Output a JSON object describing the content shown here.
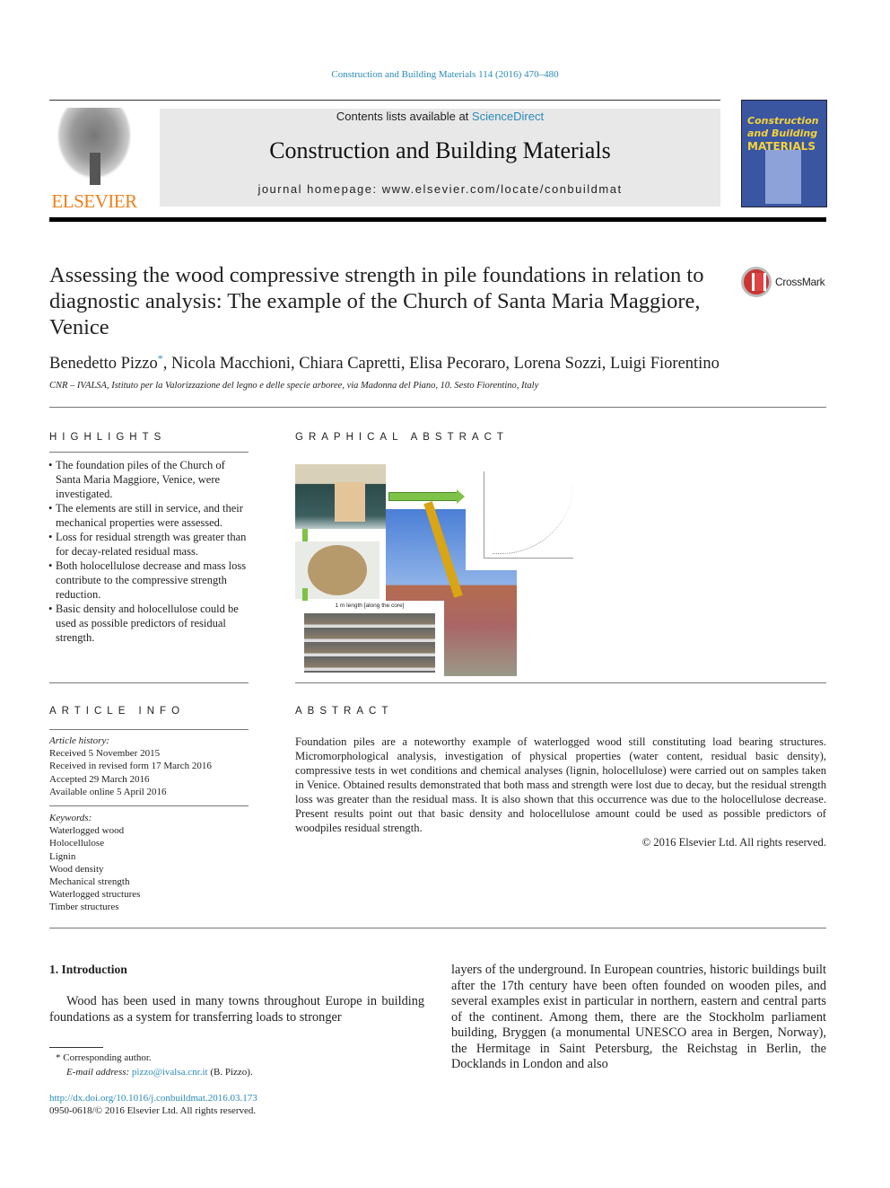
{
  "journal_ref": "Construction and Building Materials 114 (2016) 470–480",
  "header": {
    "publisher_logo_text": "ELSEVIER",
    "contents_prefix": "Contents lists available at ",
    "contents_link": "ScienceDirect",
    "journal_title": "Construction and Building Materials",
    "homepage": "journal homepage: www.elsevier.com/locate/conbuildmat",
    "cover": {
      "line1": "Construction",
      "line2": "and Building",
      "line3": "MATERIALS"
    }
  },
  "article": {
    "title": "Assessing the wood compressive strength in pile foundations in relation to diagnostic analysis: The example of the Church of Santa Maria Maggiore, Venice",
    "crossmark": "CrossMark",
    "first_author": "Benedetto Pizzo",
    "author_mark": "*",
    "other_authors": ", Nicola Macchioni, Chiara Capretti, Elisa Pecoraro, Lorena Sozzi, Luigi Fiorentino",
    "affiliation": "CNR – IVALSA, Istituto per la Valorizzazione del legno e delle specie arboree, via Madonna del Piano, 10. Sesto Fiorentino, Italy"
  },
  "highlights": {
    "heading": "HIGHLIGHTS",
    "items": [
      "The foundation piles of the Church of Santa Maria Maggiore, Venice, were investigated.",
      "The elements are still in service, and their mechanical properties were assessed.",
      "Loss for residual strength was greater than for decay-related residual mass.",
      "Both holocellulose decrease and mass loss contribute to the compressive strength reduction.",
      "Basic density and holocellulose could be used as possible predictors of residual strength."
    ]
  },
  "graphical_abstract": {
    "heading": "GRAPHICAL ABSTRACT",
    "core_caption": "1 m length [along the core]"
  },
  "article_info": {
    "heading": "ARTICLE INFO",
    "history_label": "Article history:",
    "history": [
      "Received 5 November 2015",
      "Received in revised form 17 March 2016",
      "Accepted 29 March 2016",
      "Available online 5 April 2016"
    ],
    "keywords_label": "Keywords:",
    "keywords": [
      "Waterlogged wood",
      "Holocellulose",
      "Lignin",
      "Wood density",
      "Mechanical strength",
      "Waterlogged structures",
      "Timber structures"
    ]
  },
  "abstract": {
    "heading": "ABSTRACT",
    "text": "Foundation piles are a noteworthy example of waterlogged wood still constituting load bearing structures. Micromorphological analysis, investigation of physical properties (water content, residual basic density), compressive tests in wet conditions and chemical analyses (lignin, holocellulose) were carried out on samples taken in Venice. Obtained results demonstrated that both mass and strength were lost due to decay, but the residual strength loss was greater than the residual mass. It is also shown that this occurrence was due to the holocellulose decrease. Present results point out that basic density and holocellulose amount could be used as possible predictors of woodpiles residual strength.",
    "copyright": "© 2016 Elsevier Ltd. All rights reserved."
  },
  "introduction": {
    "heading": "1. Introduction",
    "left_text": "Wood has been used in many towns throughout Europe in building foundations as a system for transferring loads to stronger",
    "right_text": "layers of the underground. In European countries, historic buildings built after the 17th century have been often founded on wooden piles, and several examples exist in particular in northern, eastern and central parts of the continent. Among them, there are the Stockholm parliament building, Bryggen (a monumental UNESCO area in Bergen, Norway), the Hermitage in Saint Petersburg, the Reichstag in Berlin, the Docklands in London and also"
  },
  "footnote": {
    "mark": "*",
    "corresponding": "Corresponding author.",
    "email_label": "E-mail address:",
    "email": "pizzo@ivalsa.cnr.it",
    "email_suffix": " (B. Pizzo).",
    "doi": "http://dx.doi.org/10.1016/j.conbuildmat.2016.03.173",
    "issn": "0950-0618/© 2016 Elsevier Ltd. All rights reserved."
  }
}
